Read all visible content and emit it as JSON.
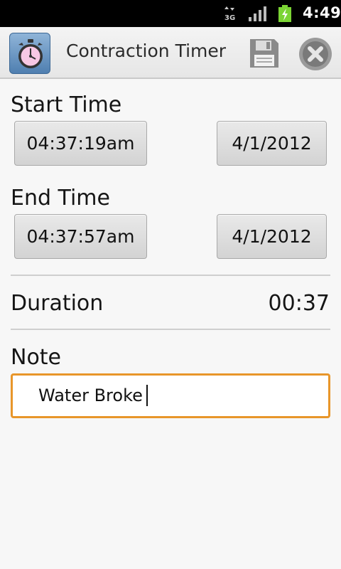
{
  "status_bar": {
    "network": "3G",
    "time": "4:49",
    "icons": [
      "network-3g-icon",
      "signal-icon",
      "battery-charging-icon"
    ]
  },
  "header": {
    "title": "Contraction Timer",
    "icons": [
      "stopwatch-app-icon",
      "save-icon",
      "close-icon"
    ]
  },
  "start": {
    "label": "Start Time",
    "time": "04:37:19am",
    "date": "4/1/2012"
  },
  "end": {
    "label": "End Time",
    "time": "04:37:57am",
    "date": "4/1/2012"
  },
  "duration": {
    "label": "Duration",
    "value": "00:37"
  },
  "note": {
    "label": "Note",
    "value": "Water Broke"
  },
  "colors": {
    "focus_border": "#e8962a",
    "status_bar_bg": "#000000",
    "battery_green": "#7bd434"
  }
}
